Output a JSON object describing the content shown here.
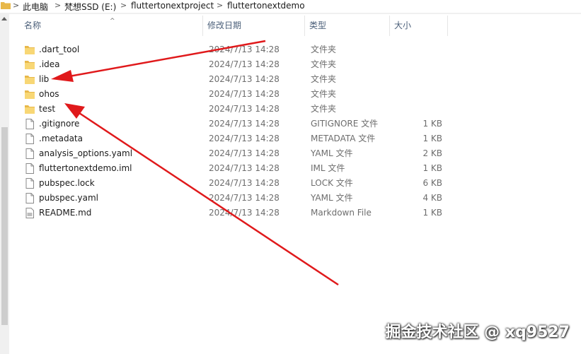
{
  "breadcrumb": {
    "items": [
      "此电脑",
      "梵想SSD (E:)",
      "fluttertonextproject",
      "fluttertonextdemo"
    ],
    "separator": ">"
  },
  "columns": {
    "name": "名称",
    "date": "修改日期",
    "type": "类型",
    "size": "大小"
  },
  "files": [
    {
      "icon": "folder-icon",
      "name": ".dart_tool",
      "date": "2024/7/13 14:28",
      "type": "文件夹",
      "size": ""
    },
    {
      "icon": "folder-icon",
      "name": ".idea",
      "date": "2024/7/13 14:28",
      "type": "文件夹",
      "size": ""
    },
    {
      "icon": "folder-icon",
      "name": "lib",
      "date": "2024/7/13 14:28",
      "type": "文件夹",
      "size": ""
    },
    {
      "icon": "folder-icon",
      "name": "ohos",
      "date": "2024/7/13 14:28",
      "type": "文件夹",
      "size": ""
    },
    {
      "icon": "folder-icon",
      "name": "test",
      "date": "2024/7/13 14:28",
      "type": "文件夹",
      "size": ""
    },
    {
      "icon": "file-icon",
      "name": ".gitignore",
      "date": "2024/7/13 14:28",
      "type": "GITIGNORE 文件",
      "size": "1 KB"
    },
    {
      "icon": "file-icon",
      "name": ".metadata",
      "date": "2024/7/13 14:28",
      "type": "METADATA 文件",
      "size": "1 KB"
    },
    {
      "icon": "file-icon",
      "name": "analysis_options.yaml",
      "date": "2024/7/13 14:28",
      "type": "YAML 文件",
      "size": "2 KB"
    },
    {
      "icon": "file-icon",
      "name": "fluttertonextdemo.iml",
      "date": "2024/7/13 14:28",
      "type": "IML 文件",
      "size": "1 KB"
    },
    {
      "icon": "file-icon",
      "name": "pubspec.lock",
      "date": "2024/7/13 14:28",
      "type": "LOCK 文件",
      "size": "6 KB"
    },
    {
      "icon": "file-icon",
      "name": "pubspec.yaml",
      "date": "2024/7/13 14:28",
      "type": "YAML 文件",
      "size": "4 KB"
    },
    {
      "icon": "markdown-file-icon",
      "name": "README.md",
      "date": "2024/7/13 14:28",
      "type": "Markdown File",
      "size": "1 KB"
    }
  ],
  "annotation_color": "#e0191b",
  "watermark": "掘金技术社区 @ xq9527"
}
